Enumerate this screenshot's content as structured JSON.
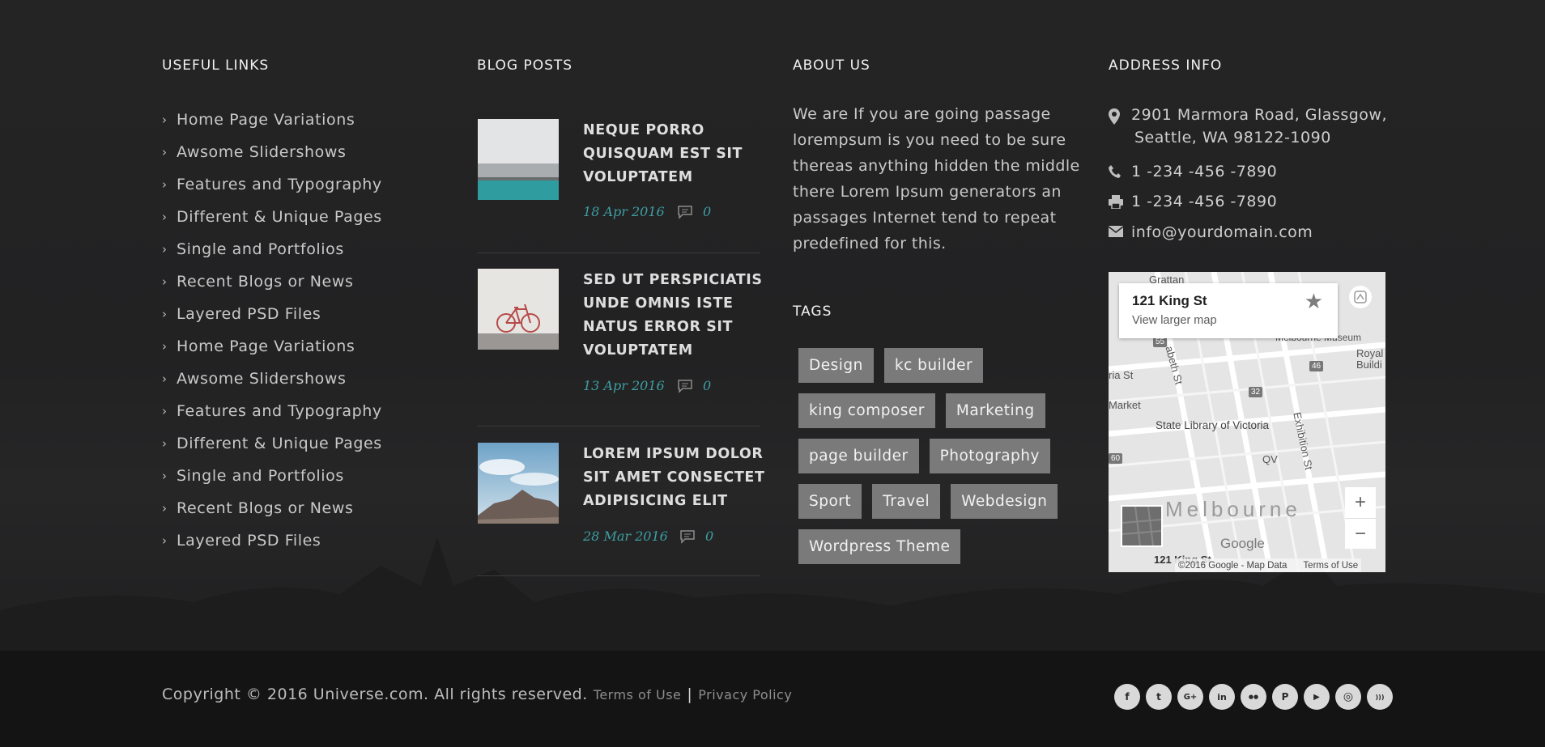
{
  "useful_links": {
    "title": "USEFUL LINKS",
    "items": [
      "Home Page Variations",
      "Awsome Slidershows",
      "Features and Typography",
      "Different & Unique Pages",
      "Single and Portfolios",
      "Recent Blogs or News",
      "Layered PSD Files",
      "Home Page Variations",
      "Awsome Slidershows",
      "Features and Typography",
      "Different & Unique Pages",
      "Single and Portfolios",
      "Recent Blogs or News",
      "Layered PSD Files"
    ]
  },
  "blog_posts": {
    "title": "BLOG POSTS",
    "posts": [
      {
        "title": "NEQUE PORRO QUISQUAM EST SIT VOLUPTATEM",
        "date": "18 Apr 2016",
        "comments": "0"
      },
      {
        "title": "SED UT PERSPICIATIS UNDE OMNIS ISTE NATUS ERROR SIT VOLUPTATEM",
        "date": "13 Apr 2016",
        "comments": "0"
      },
      {
        "title": "LOREM IPSUM DOLOR SIT AMET CONSECTET ADIPISICING ELIT",
        "date": "28 Mar 2016",
        "comments": "0"
      }
    ]
  },
  "about": {
    "title": "ABOUT US",
    "text": "We are If you are going passage lorempsum is you need to be sure thereas anything hidden the middle there Lorem Ipsum generators an passages Internet tend to repeat predefined for this."
  },
  "tags": {
    "title": "TAGS",
    "items": [
      "Design",
      "kc builder",
      "king composer",
      "Marketing",
      "page builder",
      "Photography",
      "Sport",
      "Travel",
      "Webdesign",
      "Wordpress Theme"
    ]
  },
  "address": {
    "title": "ADDRESS INFO",
    "street": "2901 Marmora Road, Glassgow,",
    "city": "Seattle, WA 98122-1090",
    "phone": "1 -234 -456 -7890",
    "fax": "1 -234 -456 -7890",
    "email": "info@yourdomain.com"
  },
  "map": {
    "place": "121 King St",
    "view_larger": "View larger map",
    "city_label": "Melbourne",
    "landmark": "State Library of Victoria",
    "market": "Market",
    "royal": "Royal Buildi",
    "museum": "Melbourne Museum",
    "qv": "QV",
    "exhibition_st": "Exhibition St",
    "elizabeth_st": "abeth St",
    "ria_st": "ria St",
    "grattan": "Grattan",
    "bottom_street": "121 King St",
    "zoom_in": "+",
    "zoom_out": "−",
    "google": "Google",
    "attribution": "©2016 Google - Map Data",
    "terms": "Terms of Use",
    "route_badges": [
      "55",
      "46",
      "32",
      "60"
    ]
  },
  "bottom": {
    "copyright": "Copyright © 2016 Universe.com. All rights reserved.",
    "terms": "Terms of Use",
    "separator": "|",
    "privacy": "Privacy Policy",
    "social": [
      {
        "icon": "facebook-icon",
        "glyph": "f"
      },
      {
        "icon": "twitter-icon",
        "glyph": "t"
      },
      {
        "icon": "google-plus-icon",
        "glyph": "G+"
      },
      {
        "icon": "linkedin-icon",
        "glyph": "in"
      },
      {
        "icon": "flickr-icon",
        "glyph": "●●"
      },
      {
        "icon": "pinterest-icon",
        "glyph": "P"
      },
      {
        "icon": "youtube-icon",
        "glyph": "▶"
      },
      {
        "icon": "instagram-icon",
        "glyph": "◎"
      },
      {
        "icon": "rss-icon",
        "glyph": ")))"
      }
    ]
  },
  "colors": {
    "background": "#232324",
    "bottom_bar": "#141414",
    "accent_teal": "#3e9ea2",
    "tag_bg": "#7a7a7b"
  }
}
